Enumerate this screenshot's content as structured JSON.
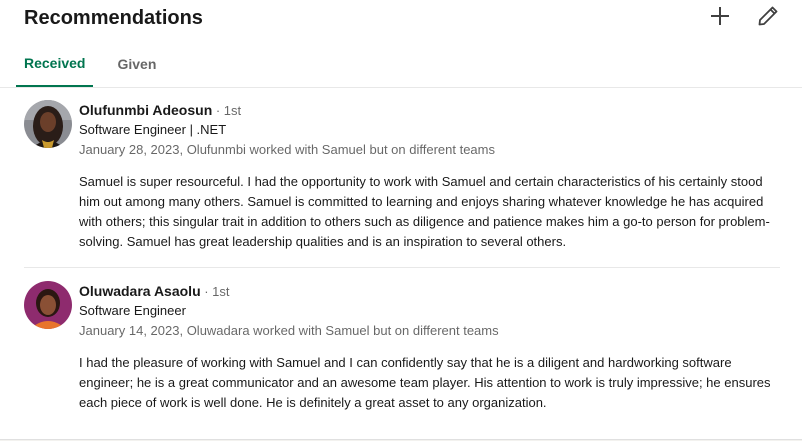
{
  "section": {
    "title": "Recommendations",
    "add_icon": "plus-icon",
    "edit_icon": "pencil-icon"
  },
  "tabs": [
    {
      "label": "Received",
      "active": true
    },
    {
      "label": "Given",
      "active": false
    }
  ],
  "colors": {
    "accent": "#01754f",
    "text_primary": "#191919",
    "text_secondary": "#666666"
  },
  "recommendations": [
    {
      "name": "Olufunmbi Adeosun",
      "degree": " · 1st",
      "headline": "Software Engineer | .NET",
      "meta": "January 28, 2023, Olufunmbi worked with Samuel but on different teams",
      "text": "Samuel is super resourceful. I had the opportunity to work with Samuel and certain characteristics of his certainly stood him out among many others. Samuel is committed to learning and enjoys sharing whatever knowledge he has acquired with others; this singular trait in addition to others such as diligence and patience makes him a go-to person for problem-solving. Samuel has great leadership qualities and is an inspiration to several others."
    },
    {
      "name": "Oluwadara Asaolu",
      "degree": " · 1st",
      "headline": "Software Engineer",
      "meta": "January 14, 2023, Oluwadara worked with Samuel but on different teams",
      "text": "I had the pleasure of working with Samuel and I can confidently say that he is a diligent and hardworking software engineer; he is a great communicator and an awesome team player. His attention to work is truly impressive; he ensures each piece of work is well done. He is definitely a great asset to any organization."
    }
  ]
}
